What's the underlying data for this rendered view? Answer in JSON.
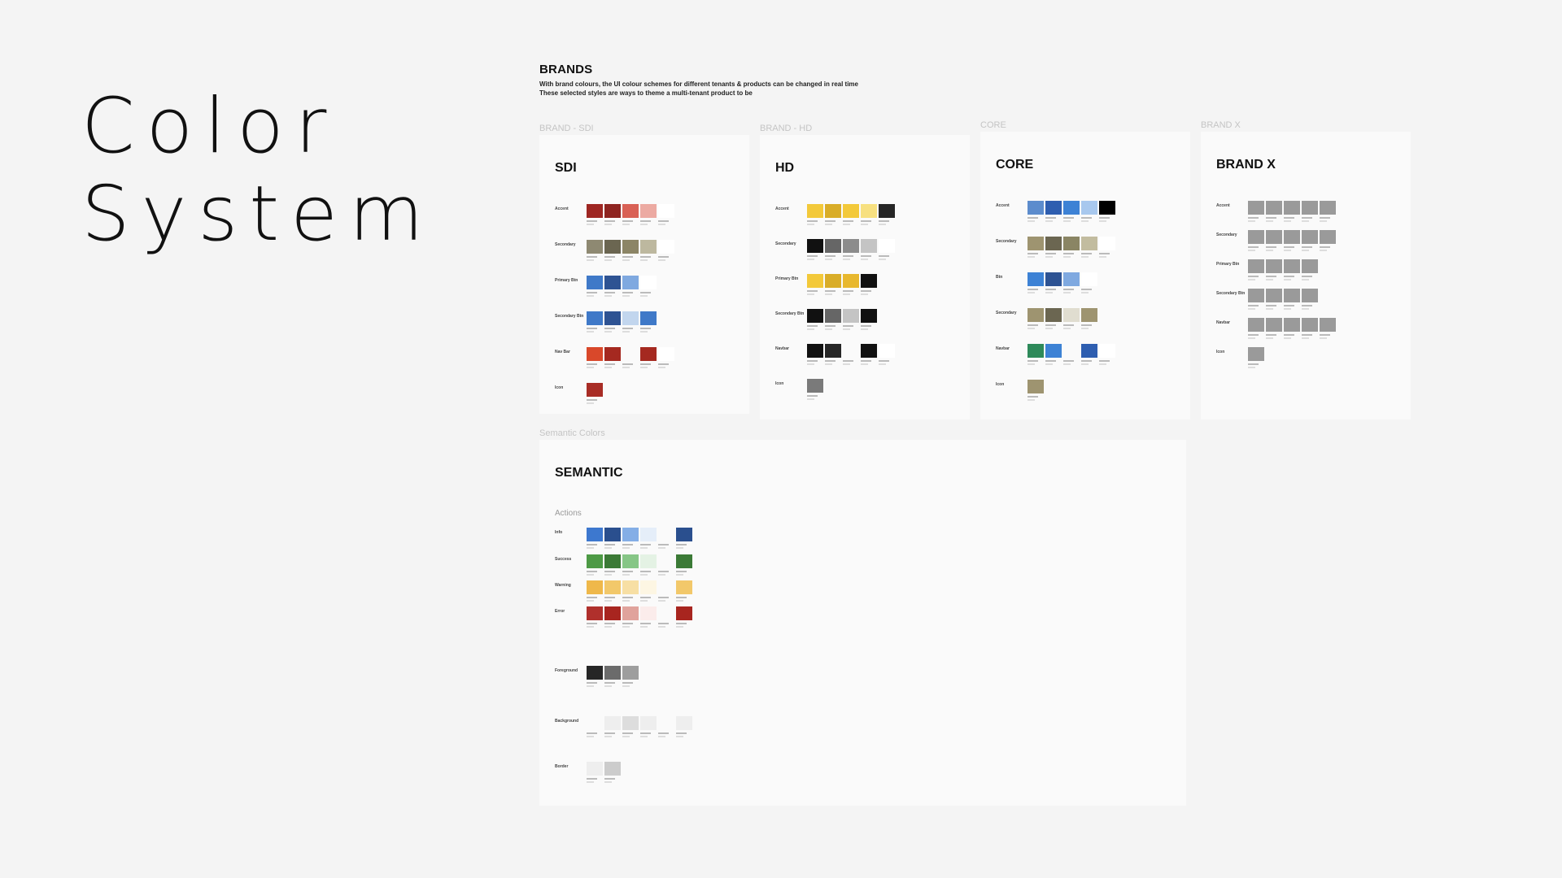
{
  "hero": {
    "line1": "Color",
    "line2": "System"
  },
  "brands": {
    "title": "BRANDS",
    "desc1": "With brand colours, the UI colour schemes for different tenants & products can be changed in real time",
    "desc2": "These selected styles are ways to theme a multi-tenant product to be"
  },
  "labels": {
    "sdi": "BRAND - SDI",
    "hd": "BRAND - HD",
    "core": "CORE",
    "brandx": "BRAND X",
    "semantic": "Semantic Colors"
  },
  "cards": {
    "sdi": {
      "title": "SDI",
      "subtitle": "",
      "rows": [
        {
          "label": "Accent",
          "colors": [
            "#9e2622",
            "#8e2420",
            "#d96155",
            "#ecaaa2",
            "#ffffff"
          ]
        },
        {
          "label": "Secondary",
          "colors": [
            "#8e8972",
            "#6b6651",
            "#8c8566",
            "#bdb89f",
            "#ffffff"
          ]
        },
        {
          "label": "Primary Btn",
          "colors": [
            "#3f79c8",
            "#2e5393",
            "#7fa9e0",
            "#ffffff"
          ]
        },
        {
          "label": "Secondary Btn",
          "colors": [
            "#3f79c8",
            "#2e5393",
            "#c2d6ee",
            "#3f79c8"
          ]
        },
        {
          "label": "Nav Bar",
          "colors": [
            "#d9482a",
            "#a52920",
            "#fafafa",
            "#a52920",
            "#ffffff"
          ]
        },
        {
          "label": "Icon",
          "colors": [
            "#a82c25"
          ]
        }
      ]
    },
    "hd": {
      "title": "HD",
      "subtitle": "",
      "rows": [
        {
          "label": "Accent",
          "colors": [
            "#f3c93a",
            "#d9ad28",
            "#f3c93a",
            "#f7e080",
            "#262626"
          ]
        },
        {
          "label": "Secondary",
          "colors": [
            "#111111",
            "#666666",
            "#8c8c8c",
            "#c4c4c4",
            "#ffffff"
          ]
        },
        {
          "label": "Primary Btn",
          "colors": [
            "#f3c93a",
            "#d9ad28",
            "#e8b82e",
            "#111111"
          ]
        },
        {
          "label": "Secondary Btn",
          "colors": [
            "#111111",
            "#666666",
            "#c4c4c4",
            "#111111"
          ]
        },
        {
          "label": "Navbar",
          "colors": [
            "#111111",
            "#262626",
            "#fafafa",
            "#111111",
            "#ffffff"
          ]
        },
        {
          "label": "Icon",
          "colors": [
            "#7a7a7a"
          ]
        }
      ]
    },
    "core": {
      "title": "CORE",
      "subtitle": "",
      "rows": [
        {
          "label": "Accent",
          "colors": [
            "#5c8ccd",
            "#2e5eb0",
            "#3d82d5",
            "#a8c8ee",
            "#000000"
          ]
        },
        {
          "label": "Secondary",
          "colors": [
            "#9e9470",
            "#6b6651",
            "#8a8564",
            "#c2bc9f",
            "#ffffff"
          ]
        },
        {
          "label": "Btn",
          "colors": [
            "#3d82d5",
            "#2e5393",
            "#7fa9e0",
            "#ffffff"
          ]
        },
        {
          "label": "Secondary",
          "colors": [
            "#9e9470",
            "#6b6651",
            "#e0ddd0",
            "#9e9470"
          ]
        },
        {
          "label": "Navbar",
          "colors": [
            "#2e8a5a",
            "#3d82d5",
            "#fafafa",
            "#2e5eb0",
            "#ffffff"
          ]
        },
        {
          "label": "Icon",
          "colors": [
            "#9e9470"
          ]
        }
      ]
    },
    "brandx": {
      "title": "BRAND X",
      "subtitle": "",
      "rows": [
        {
          "label": "Accent",
          "colors": [
            "#9a9a9a",
            "#9a9a9a",
            "#9a9a9a",
            "#9a9a9a",
            "#9a9a9a"
          ]
        },
        {
          "label": "Secondary",
          "colors": [
            "#9a9a9a",
            "#9a9a9a",
            "#9a9a9a",
            "#9a9a9a",
            "#9a9a9a"
          ]
        },
        {
          "label": "Primary Btn",
          "colors": [
            "#9a9a9a",
            "#9a9a9a",
            "#9a9a9a",
            "#9a9a9a"
          ]
        },
        {
          "label": "Secondary Btn",
          "colors": [
            "#9a9a9a",
            "#9a9a9a",
            "#9a9a9a",
            "#9a9a9a"
          ]
        },
        {
          "label": "Navbar",
          "colors": [
            "#9a9a9a",
            "#9a9a9a",
            "#9a9a9a",
            "#9a9a9a",
            "#9a9a9a"
          ]
        },
        {
          "label": "Icon",
          "colors": [
            "#9a9a9a"
          ]
        }
      ]
    },
    "semantic": {
      "title": "SEMANTIC",
      "subtitle": "",
      "actions": "Actions",
      "rows": [
        {
          "label": "Info",
          "colors": [
            "#3d78cf",
            "#2a4f8e",
            "#84aee6",
            "#e5eef9",
            "#fafafa",
            "#2a4f8e"
          ]
        },
        {
          "label": "Success",
          "colors": [
            "#4d9a45",
            "#3b7a36",
            "#86c686",
            "#e4f2e4",
            "#fafafa",
            "#3b7a36"
          ]
        },
        {
          "label": "Warning",
          "colors": [
            "#efb84a",
            "#f2c86a",
            "#f7dfa4",
            "#fdf6e3",
            "#fafafa",
            "#f2c86a"
          ]
        },
        {
          "label": "Error",
          "colors": [
            "#b0302c",
            "#a8251f",
            "#e0a39c",
            "#fbeceb",
            "#fafafa",
            "#a8251f"
          ]
        },
        {
          "label": "Foreground",
          "colors": [
            "#262626",
            "#6b6b6b",
            "#9e9e9e"
          ]
        },
        {
          "label": "Background",
          "colors": [
            "#fafafa",
            "#eeeeee",
            "#dddddd",
            "#eeeeee",
            "#fafafa",
            "#eeeeee"
          ]
        },
        {
          "label": "Border",
          "colors": [
            "#eeeeee",
            "#cccccc"
          ]
        }
      ]
    }
  }
}
